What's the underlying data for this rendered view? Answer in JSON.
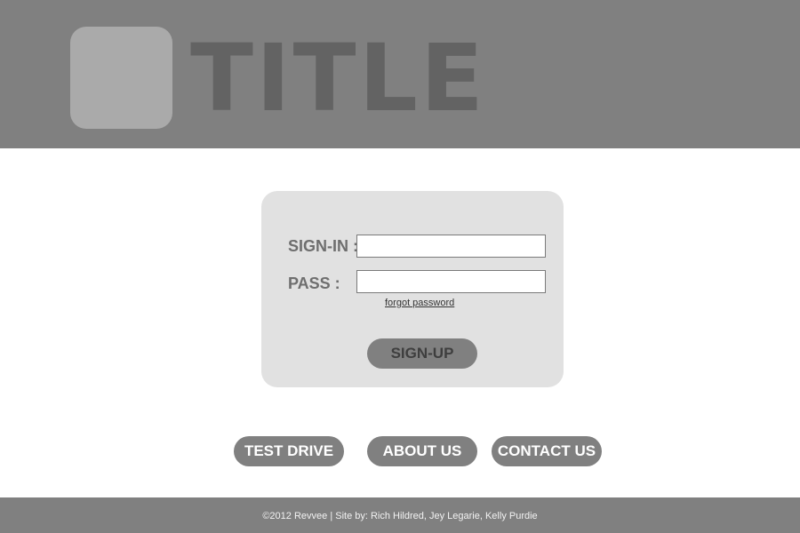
{
  "header": {
    "title": "TITLE"
  },
  "login": {
    "signin_label": "SIGN-IN :",
    "signin_value": "",
    "pass_label": "PASS :",
    "pass_value": "",
    "forgot_link": "forgot password",
    "signup_button": "SIGN-UP"
  },
  "nav": {
    "items": [
      {
        "label": "TEST DRIVE"
      },
      {
        "label": "ABOUT US"
      },
      {
        "label": "CONTACT US"
      }
    ]
  },
  "footer": {
    "text": "©2012 Revvee | Site by: Rich Hildred, Jey Legarie, Kelly Purdie"
  },
  "colors": {
    "header_bg": "#808080",
    "logo_placeholder": "#aaaaaa",
    "title_text": "#636363",
    "card_bg": "#e1e1e1",
    "button_bg": "#808080",
    "page_bg": "#ffffff"
  }
}
